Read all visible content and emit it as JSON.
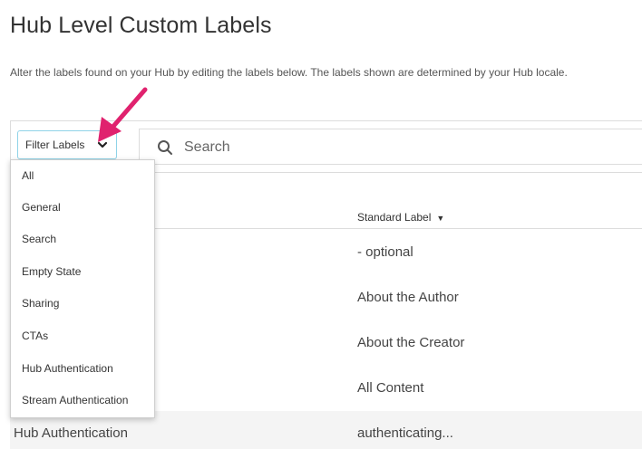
{
  "page": {
    "title": "Hub Level Custom Labels",
    "description": "Alter the labels found on your Hub by editing the labels below. The labels shown are determined by your Hub locale."
  },
  "toolbar": {
    "filter_label": "Filter Labels",
    "search_placeholder": "Search"
  },
  "table": {
    "standard_header": "Standard Label",
    "rows": [
      {
        "custom": "",
        "standard": "- optional"
      },
      {
        "custom": "",
        "standard": "About the Author"
      },
      {
        "custom": "",
        "standard": "About the Creator"
      },
      {
        "custom": "",
        "standard": "All Content"
      },
      {
        "custom": "Hub Authentication",
        "standard": "authenticating..."
      }
    ]
  },
  "filter_menu": {
    "items": [
      "All",
      "General",
      "Search",
      "Empty State",
      "Sharing",
      "CTAs",
      "Hub Authentication",
      "Stream Authentication"
    ]
  },
  "colors": {
    "accent_border": "#8fd3e8",
    "annotation_arrow": "#e0226e",
    "row_shade": "#f4f4f4"
  },
  "icons": {
    "search": "search-icon",
    "chevron": "chevron-down-icon",
    "sort": "sort-down-icon",
    "annotation": "arrow-annotation"
  }
}
